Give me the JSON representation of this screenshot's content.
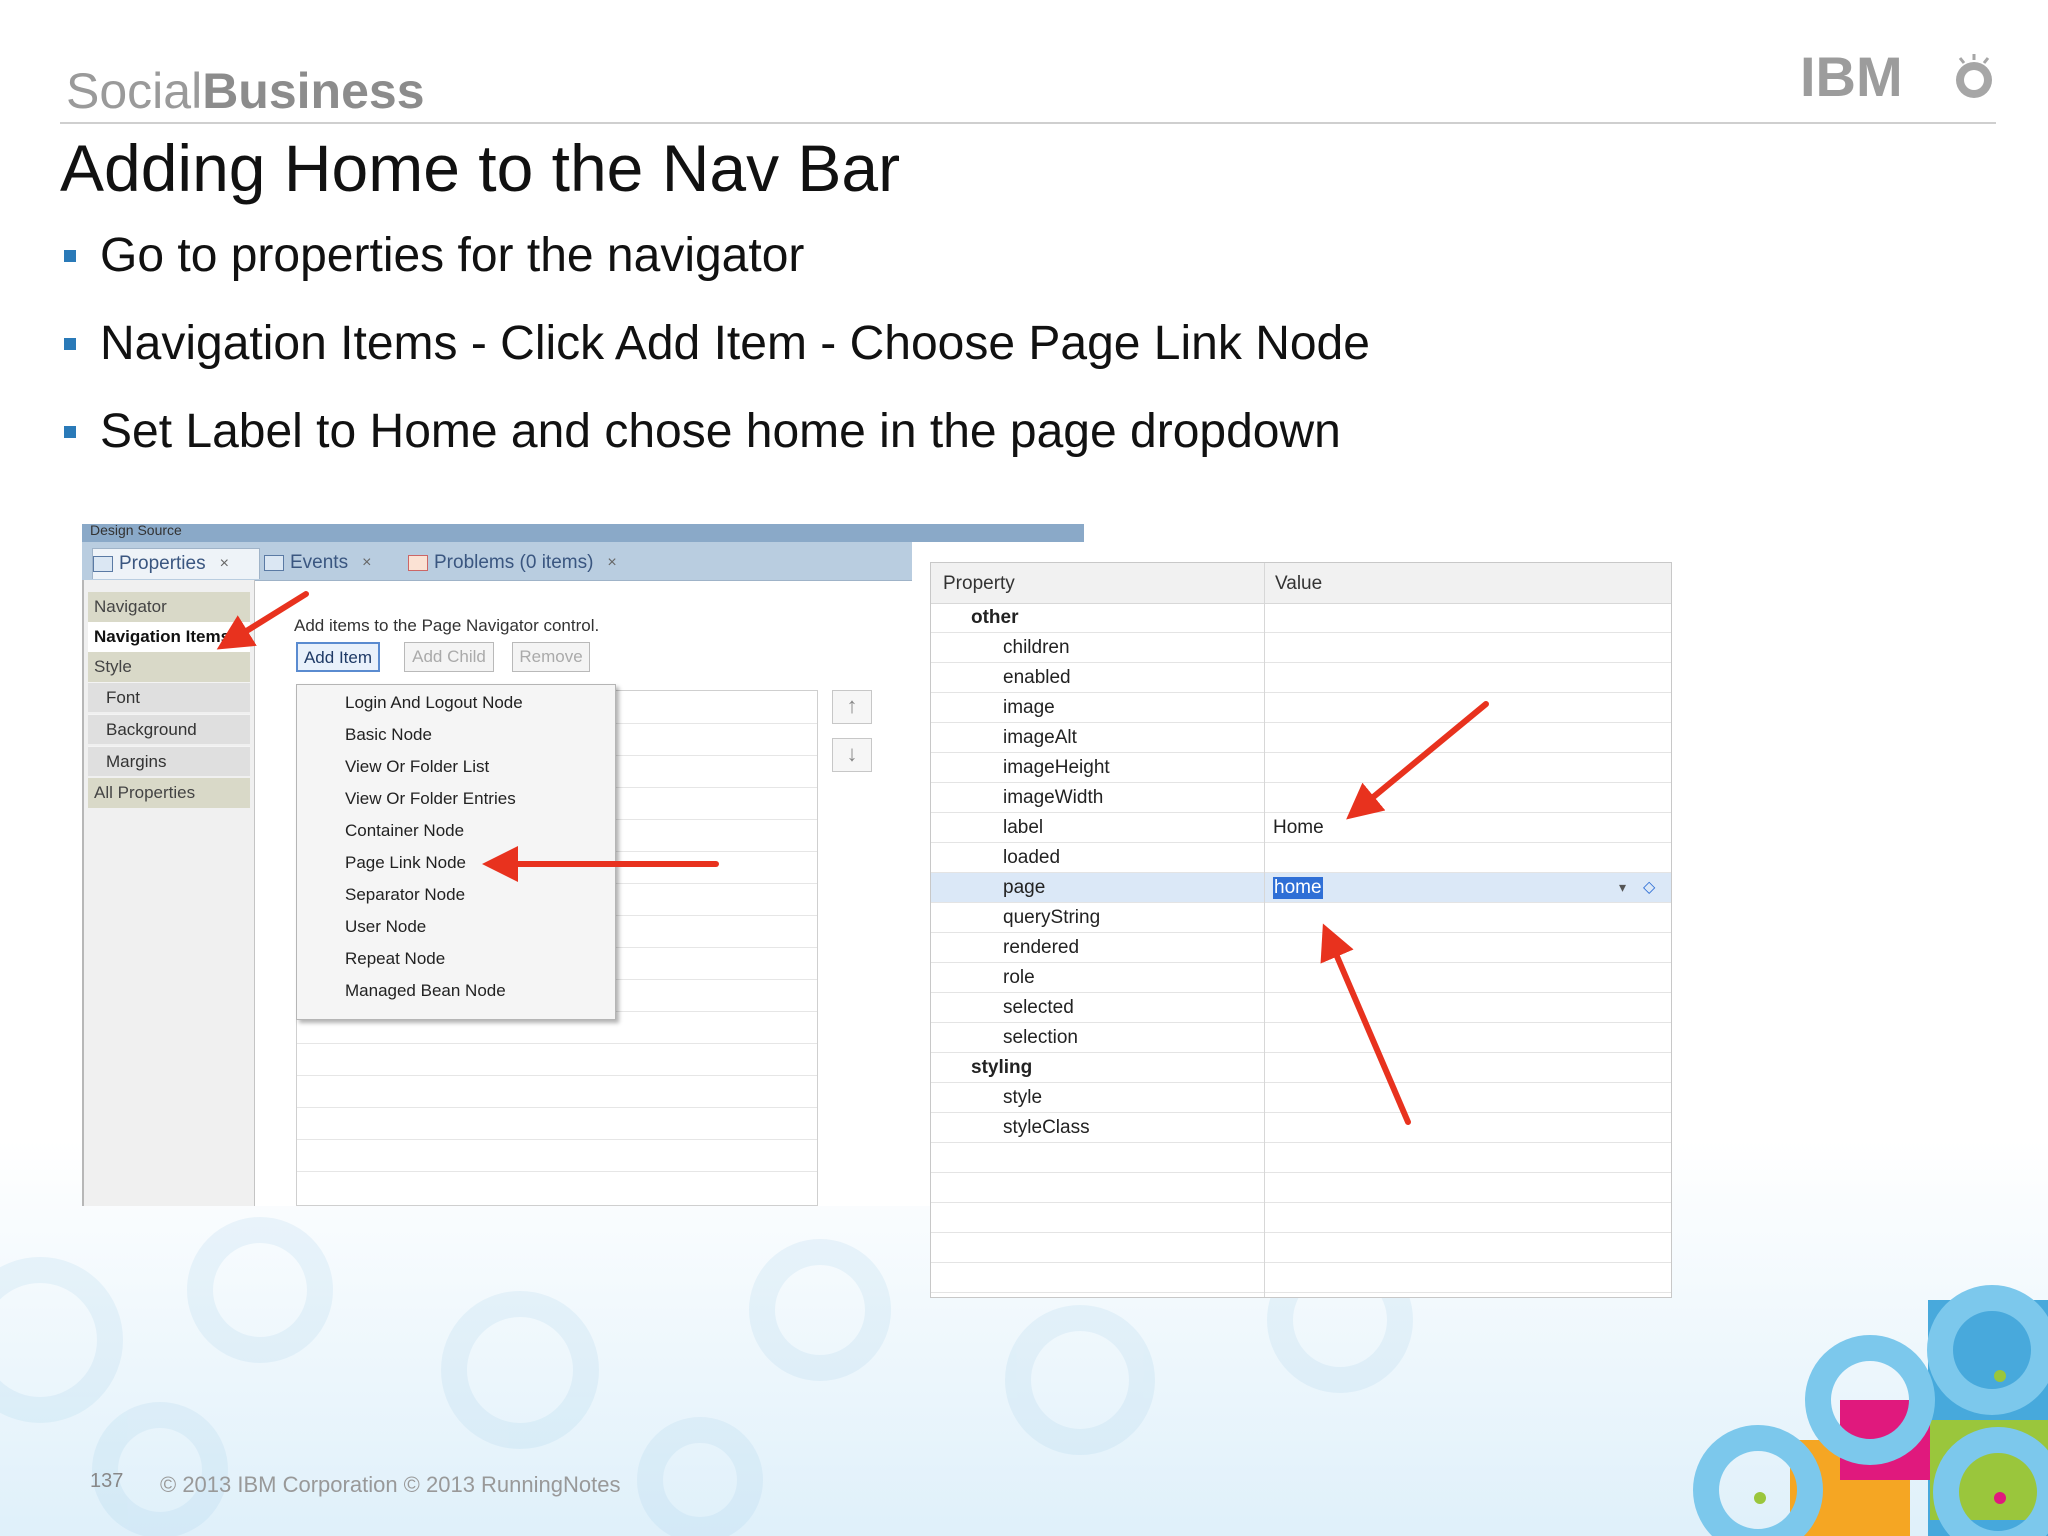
{
  "header": {
    "brand_left": "Social",
    "brand_right": "Business",
    "logo_text": "IBM"
  },
  "slide": {
    "title": "Adding Home to the Nav Bar",
    "bullets": [
      "Go to properties for the navigator",
      "Navigation Items - Click Add Item - Choose Page Link Node",
      "Set Label to Home and chose home in the page dropdown"
    ]
  },
  "left_screenshot": {
    "top_strip": "Design  Source",
    "tabs": [
      {
        "label": "Properties",
        "close": "×"
      },
      {
        "label": "Events",
        "close": "×"
      },
      {
        "label": "Problems (0 items)",
        "close": "×"
      }
    ],
    "nav_items": [
      "Navigator",
      "Navigation Items",
      "Style",
      "Font",
      "Background",
      "Margins",
      "All Properties"
    ],
    "hint": "Add items to the Page Navigator control.",
    "buttons": {
      "add_item": "Add Item",
      "add_child": "Add Child",
      "remove": "Remove"
    },
    "menu_items": [
      "Login And Logout Node",
      "Basic Node",
      "View Or Folder List",
      "View Or Folder Entries",
      "Container Node",
      "Page Link Node",
      "Separator Node",
      "User Node",
      "Repeat Node",
      "Managed Bean Node"
    ],
    "move_up": "↑",
    "move_down": "↓"
  },
  "right_screenshot": {
    "col_property": "Property",
    "col_value": "Value",
    "rows": [
      {
        "name": "other",
        "value": "",
        "category": true
      },
      {
        "name": "children",
        "value": ""
      },
      {
        "name": "enabled",
        "value": ""
      },
      {
        "name": "image",
        "value": ""
      },
      {
        "name": "imageAlt",
        "value": ""
      },
      {
        "name": "imageHeight",
        "value": ""
      },
      {
        "name": "imageWidth",
        "value": ""
      },
      {
        "name": "label",
        "value": "Home"
      },
      {
        "name": "loaded",
        "value": ""
      },
      {
        "name": "page",
        "value": "home",
        "selected": true
      },
      {
        "name": "queryString",
        "value": ""
      },
      {
        "name": "rendered",
        "value": ""
      },
      {
        "name": "role",
        "value": ""
      },
      {
        "name": "selected",
        "value": ""
      },
      {
        "name": "selection",
        "value": ""
      },
      {
        "name": "styling",
        "value": "",
        "category": true
      },
      {
        "name": "style",
        "value": ""
      },
      {
        "name": "styleClass",
        "value": ""
      }
    ]
  },
  "footer": {
    "page_number": "137",
    "copyright": "© 2013 IBM Corporation  © 2013 RunningNotes"
  },
  "colors": {
    "bullet": "#2a7ab8",
    "arrow": "#e8321e",
    "deco_cyan": "#7cc8ec",
    "deco_magenta": "#e0197d",
    "deco_orange": "#f5a623",
    "deco_green": "#9ac63c"
  }
}
